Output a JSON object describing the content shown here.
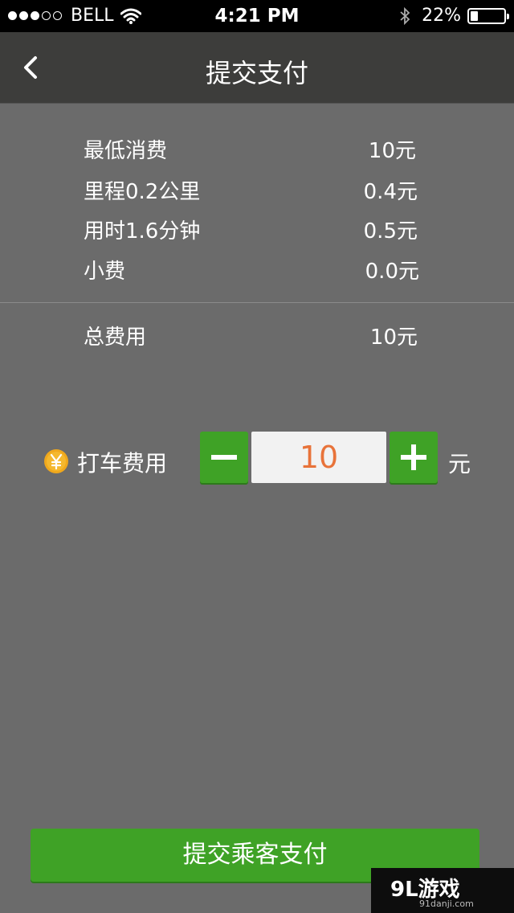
{
  "status_bar": {
    "carrier": "BELL",
    "time": "4:21 PM",
    "battery_percent": "22%",
    "battery_level": 0.22,
    "signal_dots_on": 3,
    "signal_dots_total": 5
  },
  "nav": {
    "title": "提交支付",
    "back_icon": "chevron-left-icon"
  },
  "fees": [
    {
      "label": "最低消费",
      "value": "10元"
    },
    {
      "label": "里程0.2公里",
      "value": "0.4元"
    },
    {
      "label": "用时1.6分钟",
      "value": "0.5元"
    },
    {
      "label": "小费",
      "value": "0.0元"
    }
  ],
  "total": {
    "label": "总费用",
    "value": "10元"
  },
  "fare": {
    "label": "打车费用",
    "value": "10",
    "unit": "元",
    "coin_icon": "yen-coin-icon",
    "minus_icon": "minus-icon",
    "plus_icon": "plus-icon"
  },
  "submit": {
    "label": "提交乘客支付"
  },
  "watermark": {
    "main": "9L游戏",
    "sub": "91danji.com"
  },
  "colors": {
    "accent_green": "#3fa226",
    "fare_value_orange": "#e8733a",
    "background": "#6b6b6b",
    "nav_background": "#3d3d3b",
    "coin_yellow": "#f0a81c"
  }
}
